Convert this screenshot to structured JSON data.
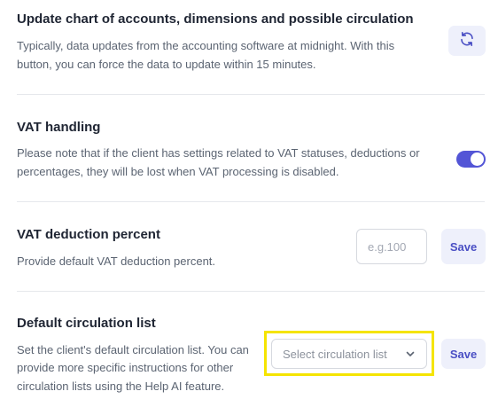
{
  "sections": {
    "update_chart": {
      "title": "Update chart of accounts, dimensions and possible circulation",
      "description_line1": "Typically, data updates from the accounting software at midnight. With this",
      "description_line2": "button, you can force the data to update within 15 minutes.",
      "refresh_icon": "refresh-icon"
    },
    "vat_handling": {
      "title": "VAT handling",
      "description_line1": "Please note that if the client has settings related to VAT statuses, deductions or",
      "description_line2": "percentages, they will be lost when VAT processing is disabled.",
      "toggle_on": true
    },
    "vat_deduction": {
      "title": "VAT deduction percent",
      "description": "Provide default VAT deduction percent.",
      "input_placeholder": "e.g.100",
      "input_value": "",
      "save_label": "Save"
    },
    "circulation": {
      "title": "Default circulation list",
      "description_line1": "Set the client's default circulation list. You can",
      "description_line2": "provide more specific instructions for other",
      "description_line3": "circulation lists using the Help AI feature.",
      "select_placeholder": "Select circulation list",
      "chevron_icon": "chevron-down-icon",
      "save_label": "Save"
    }
  },
  "colors": {
    "accent": "#5355d6",
    "button_bg": "#eef0fb",
    "button_text": "#4a4fc4",
    "highlight": "#f5e400",
    "divider": "#e6e8ec"
  }
}
